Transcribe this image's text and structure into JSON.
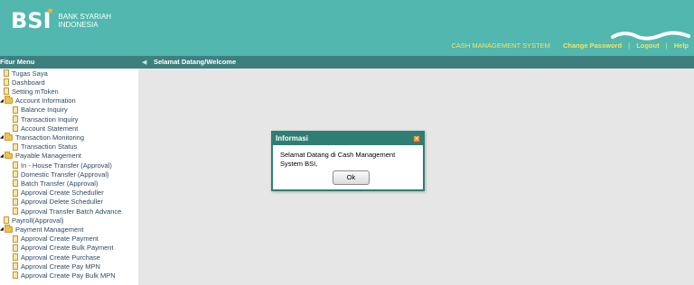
{
  "brand": {
    "mark": "BSI",
    "line1": "BANK SYARIAH",
    "line2": "INDONESIA",
    "star_color": "#f2b43a"
  },
  "top_links": {
    "system": "CASH MANAGEMENT SYSTEM",
    "change_password": "Change Password",
    "sep": "|",
    "logout": "Logout",
    "help": "Help"
  },
  "navbar": {
    "left_title": "Fitur Menu",
    "page_title": "Selamat Datang/Welcome"
  },
  "menu": {
    "tugas_saya": "Tugas Saya",
    "dashboard": "Dashboard",
    "setting_mtoken": "Setting mToken",
    "account_information": "Account Information",
    "balance_inquiry": "Balance Inquiry",
    "transaction_inquiry": "Transaction Inquiry",
    "account_statement": "Account Statement",
    "transaction_monitoring": "Transaction Monitoring",
    "transaction_status": "Transaction Status",
    "payable_management": "Payable Management",
    "in_house_transfer": "In - House Transfer (Approval)",
    "domestic_transfer": "Domestic Transfer (Approval)",
    "batch_transfer": "Batch Transfer (Approval)",
    "approval_create_scheduller": "Approval Create Scheduller",
    "approval_delete_scheduller": "Approval Delete Scheduller",
    "approval_transfer_batch_advance": "Approval Transfer Batch Advance",
    "payroll": "Payroll(Approval)",
    "payment_management": "Payment Management",
    "approval_create_payment": "Approval Create Payment",
    "approval_create_bulk_payment": "Approval Create Bulk Payment",
    "approval_create_purchase": "Approval Create Purchase",
    "approval_create_pay_mpn": "Approval Create Pay MPN",
    "approval_create_pay_bulk_mpn": "Approval Create Pay Bulk MPN"
  },
  "dialog": {
    "title": "Informasi",
    "close_glyph": "✕",
    "message": "Selamat Datang di Cash Management System BSI,",
    "ok_label": "Ok"
  },
  "colors": {
    "header": "#52b7ae",
    "navbar": "#3e7f7d",
    "dialog_border": "#2f7e74",
    "link_yellow": "#f5e35c"
  }
}
